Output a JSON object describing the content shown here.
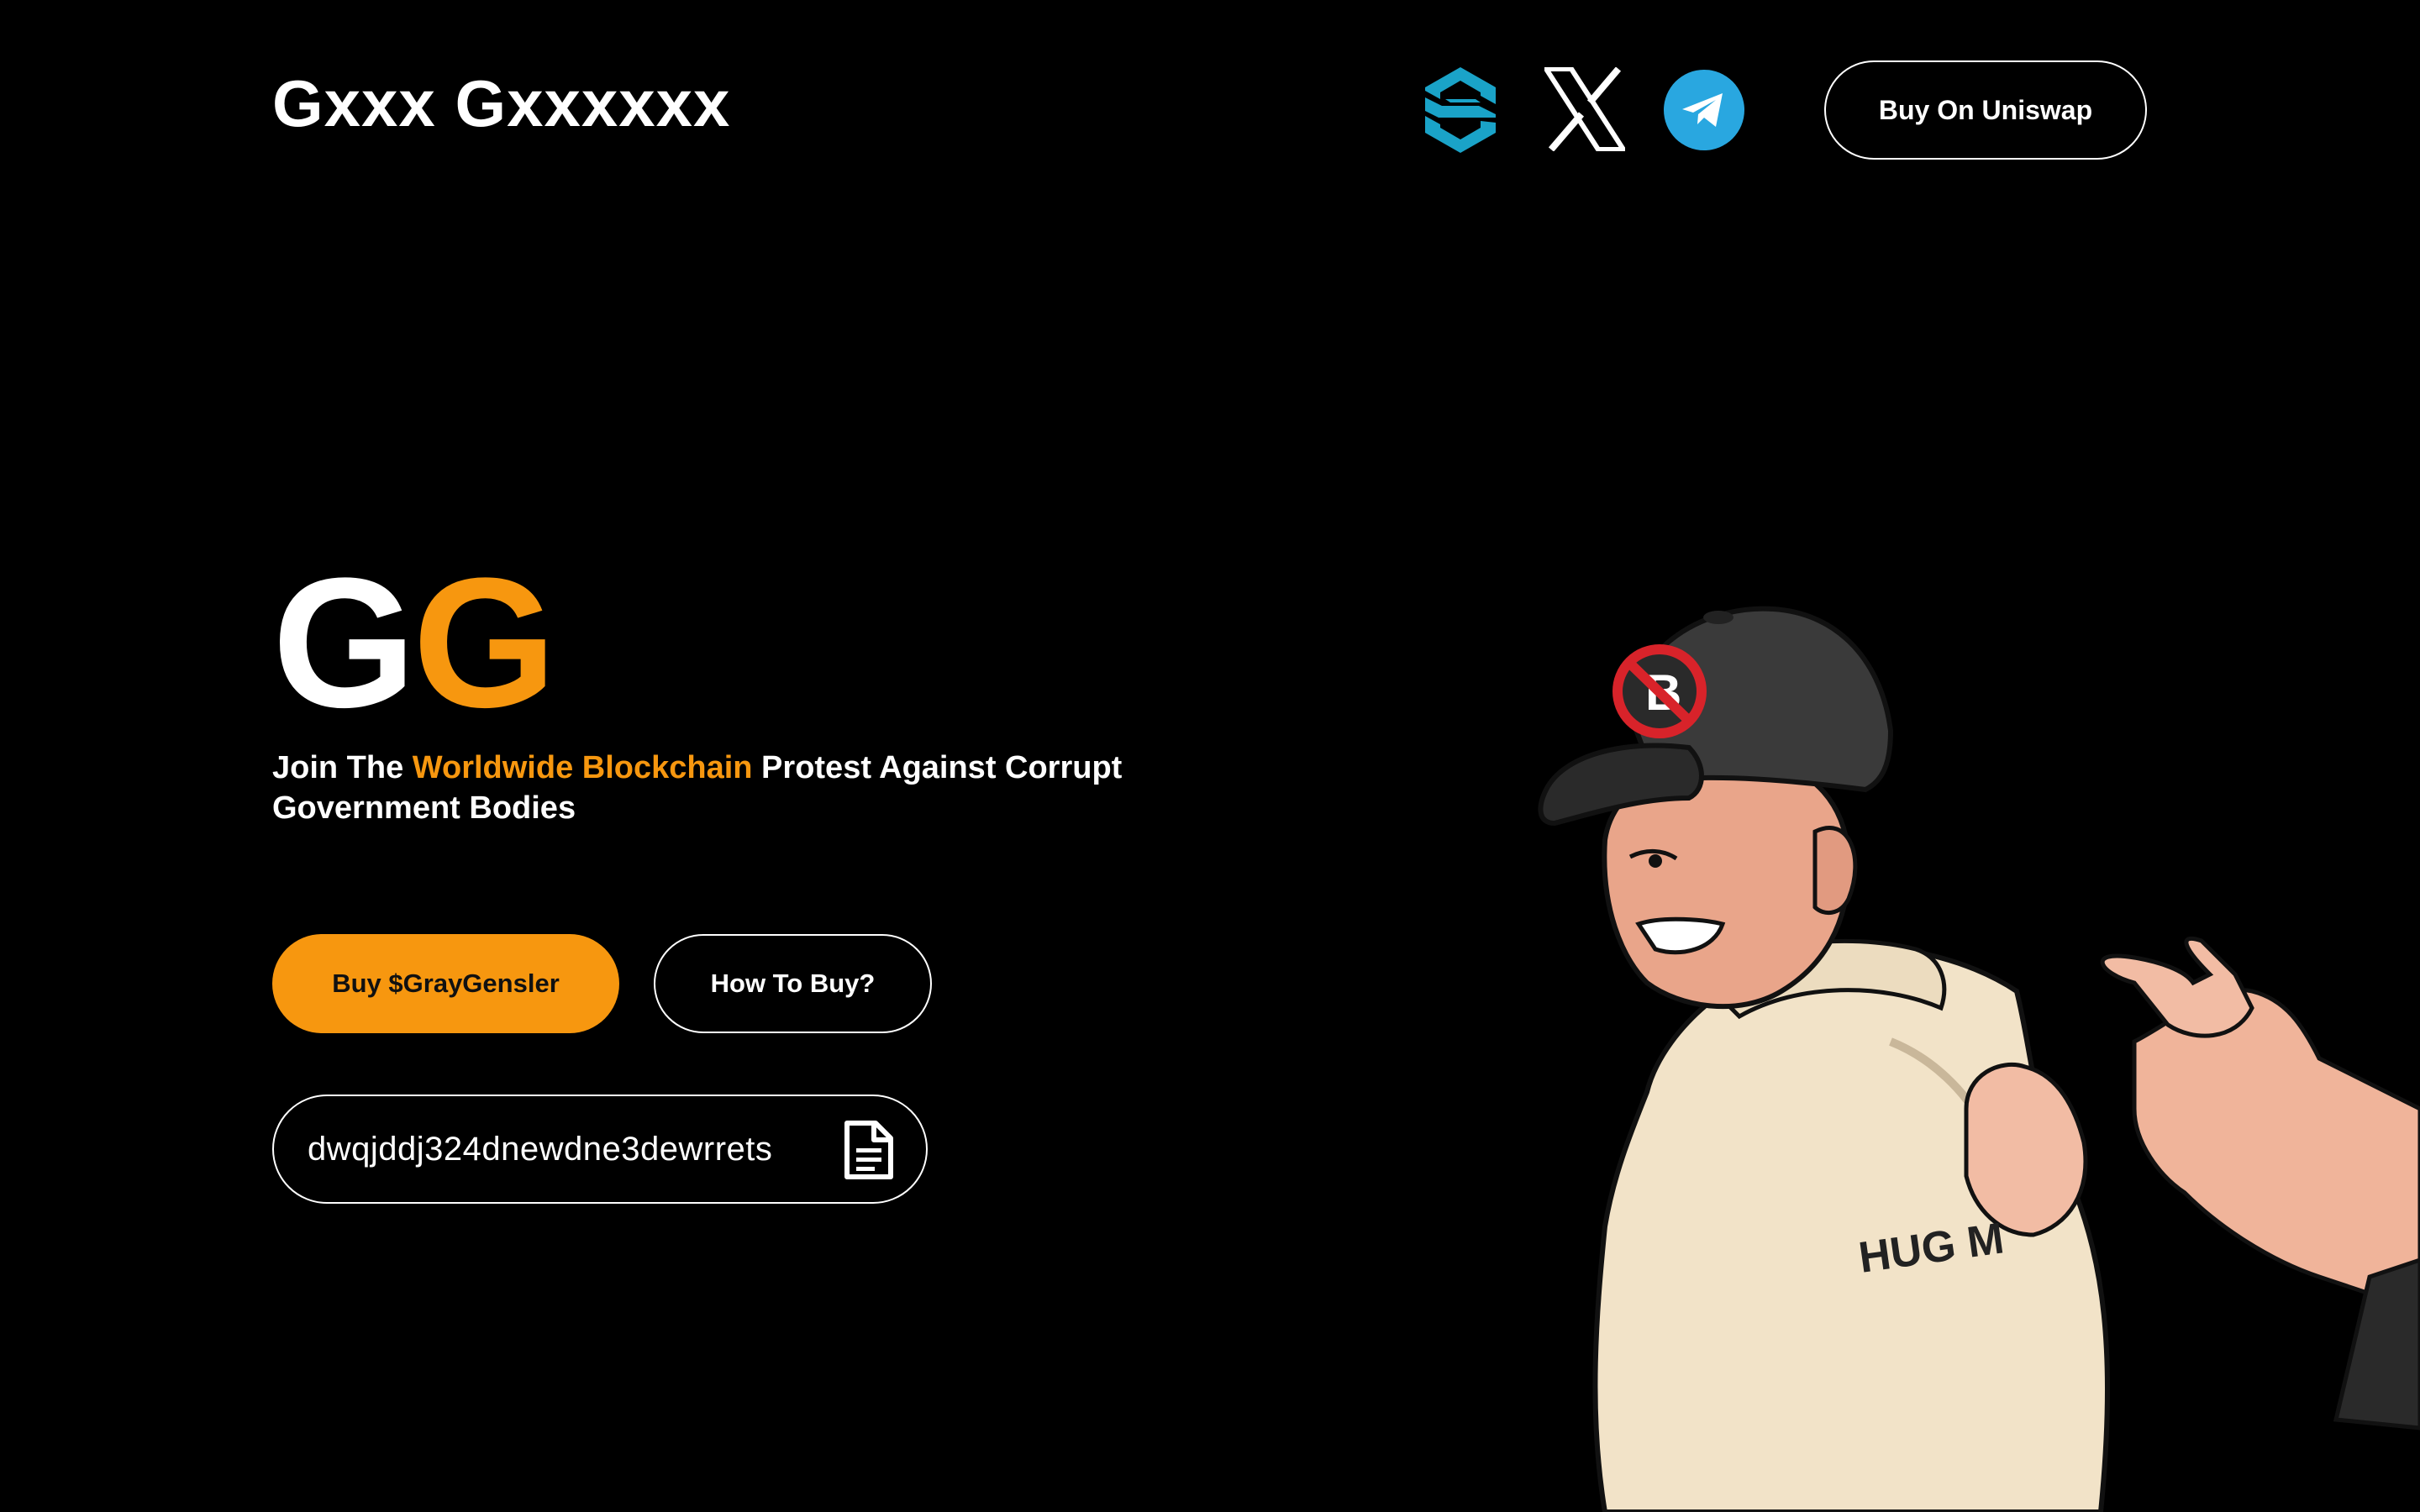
{
  "header": {
    "brand": "Gxxx Gxxxxxx",
    "buy_uniswap_label": "Buy On Uniswap",
    "icons": [
      "dextools-icon",
      "x-icon",
      "telegram-icon"
    ]
  },
  "hero": {
    "logo_letter_1": "G",
    "logo_letter_2": "G",
    "tagline_prefix": "Join The ",
    "tagline_highlight": "Worldwide Blockchain",
    "tagline_suffix": " Protest Against Corrupt Government Bodies",
    "buy_label": "Buy $GrayGensler",
    "howto_label": "How To Buy?",
    "contract_address": "dwqjddj324dnewdne3dewrrets",
    "hoodie_text": "HUG M"
  },
  "colors": {
    "background": "#000000",
    "accent": "#f7970f",
    "telegram": "#29a7e0",
    "dextools": "#1aa3c8"
  }
}
